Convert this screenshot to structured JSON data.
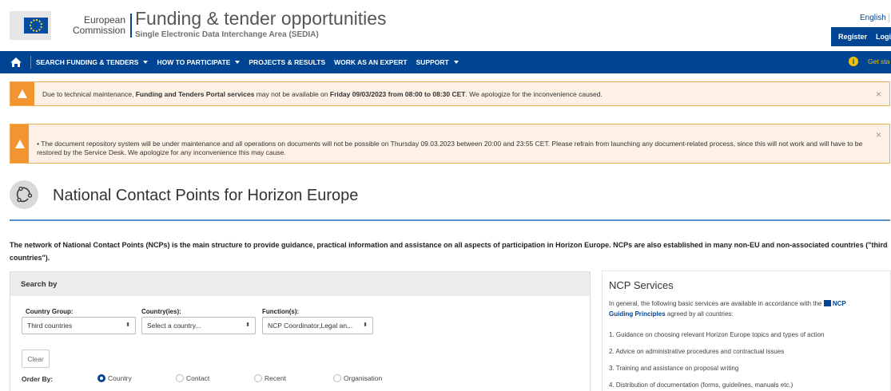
{
  "header": {
    "ec_line1": "European",
    "ec_line2": "Commission",
    "title": "Funding & tender opportunities",
    "subtitle": "Single Electronic Data Interchange Area (SEDIA)",
    "language": "English",
    "register_label": "Register",
    "login_label": "Logi"
  },
  "nav": {
    "items": [
      {
        "label": "SEARCH FUNDING & TENDERS",
        "dropdown": true
      },
      {
        "label": "HOW TO PARTICIPATE",
        "dropdown": true
      },
      {
        "label": "PROJECTS & RESULTS",
        "dropdown": false
      },
      {
        "label": "WORK AS AN EXPERT",
        "dropdown": false
      },
      {
        "label": "SUPPORT",
        "dropdown": true
      }
    ],
    "get_started": "Get sta"
  },
  "alerts": [
    {
      "pre": "Due to technical maintenance, ",
      "bold1": "Funding and Tenders Portal services",
      "mid": " may not be available on ",
      "bold2": "Friday 09/03/2023 from 08:00 to 08:30 CET",
      "post": ". We apologize for the inconvenience caused.",
      "close": "×"
    },
    {
      "text": "• The document repository system will be under maintenance and all operations on documents will not be possible on Thursday 09.03.2023 between 20:00 and 23:55 CET. Please refrain from launching any document-related process, since this will not work and will have to be restored by the Service Desk. We apologize for any inconvenience this may cause.",
      "close": "×"
    }
  ],
  "page": {
    "title": "National Contact Points for Horizon Europe",
    "intro": "The network of National Contact Points (NCPs) is the main structure to provide guidance, practical information and assistance on all aspects of participation in Horizon Europe. NCPs are also established in many non-EU and non-associated countries (\"third countries\")."
  },
  "search": {
    "heading": "Search by",
    "country_group_label": "Country Group:",
    "country_group_value": "Third countries",
    "countries_label": "Country(ies):",
    "countries_value": "Select a country...",
    "functions_label": "Function(s):",
    "functions_value": "NCP Coordinator,Legal an...",
    "select_arrows": "⬍",
    "clear_label": "Clear",
    "order_by_label": "Order By:",
    "order_options": [
      "Country",
      "Contact",
      "Recent",
      "Organisation"
    ],
    "order_selected": "Country"
  },
  "services": {
    "title": "NCP Services",
    "intro_pre": "In general, the following basic services are available in accordance with the ",
    "link_text_1": "NCP",
    "link_text_2": "Guiding Principles",
    "intro_post": " agreed by all countries:",
    "items": [
      "1.   Guidance on choosing relevant Horizon Europe topics and types of action",
      "2.   Advice on administrative procedures and contractual issues",
      "3.   Training and assistance on proposal writing",
      "4.   Distribution of documentation (forms, guidelines, manuals etc.)"
    ]
  },
  "colors": {
    "brand_blue": "#004494",
    "alert_orange": "#f29530",
    "get_started_yellow": "#f2c300"
  }
}
